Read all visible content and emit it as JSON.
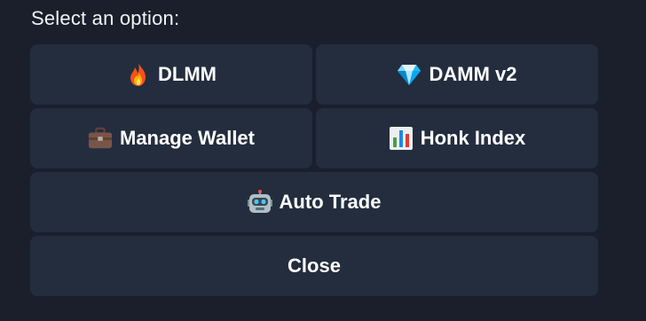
{
  "prompt": "Select an option:",
  "buttons": {
    "dlmm": {
      "label": "DLMM",
      "icon": "fire-icon"
    },
    "damm": {
      "label": "DAMM v2",
      "icon": "gem-icon"
    },
    "wallet": {
      "label": "Manage Wallet",
      "icon": "briefcase-icon"
    },
    "honk": {
      "label": "Honk Index",
      "icon": "bar-chart-icon"
    },
    "auto": {
      "label": "Auto Trade",
      "icon": "robot-icon"
    },
    "close": {
      "label": "Close"
    }
  },
  "colors": {
    "background": "#1a1f2b",
    "button": "#232d3e",
    "text": "#ffffff"
  }
}
